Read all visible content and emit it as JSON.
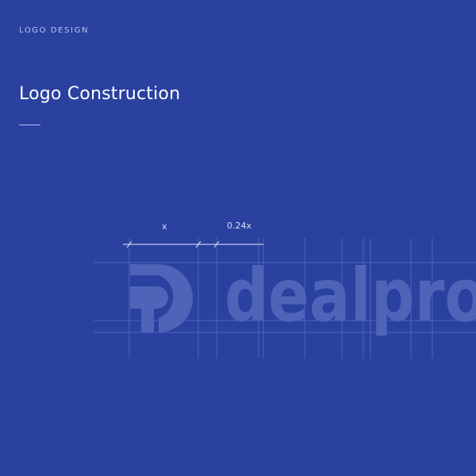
{
  "header": {
    "eyebrow": "LOGO DESIGN",
    "title": "Logo Construction"
  },
  "construction": {
    "logo_wordmark": "dealpro",
    "dimension_x_label": "x",
    "dimension_ratio_label": "0.24x"
  },
  "colors": {
    "background": "#2a41a0",
    "logo_fill": "#4e64b8",
    "guide_line": "#4f65b8",
    "dimension_line": "#e4e9fb"
  }
}
